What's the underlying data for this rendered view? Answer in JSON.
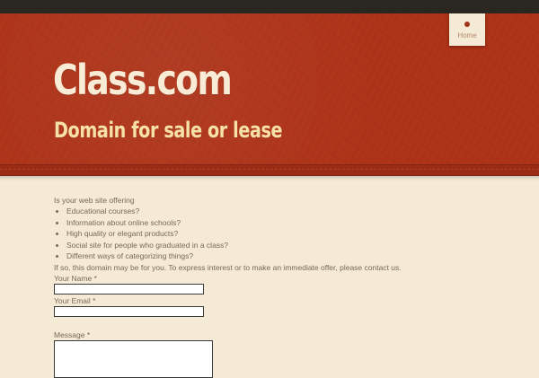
{
  "nav": {
    "home_label": "Home"
  },
  "header": {
    "title": "Class.com",
    "tagline": "Domain for sale or lease"
  },
  "content": {
    "intro": "Is your web site offering",
    "list_items": [
      "Educational courses?",
      "Information about online schools?",
      "High quality or elegant products?",
      "Social site for people who graduated in a class?",
      "Different ways of categorizing things?"
    ],
    "outro": "If so, this domain may be for you. To express interest or to make an immediate offer, please contact us."
  },
  "form": {
    "name_label": "Your Name *",
    "email_label": "Your Email *",
    "message_label": "Message *",
    "name_value": "",
    "email_value": "",
    "message_value": ""
  },
  "colors": {
    "header_red": "#ad3217",
    "top_bar": "#2a2723",
    "page_background": "#f4ead6",
    "title_text": "#f8ecd6",
    "tagline_text": "#f6e2a8",
    "body_text": "#7a6a52",
    "nav_dot": "#a8321a"
  }
}
